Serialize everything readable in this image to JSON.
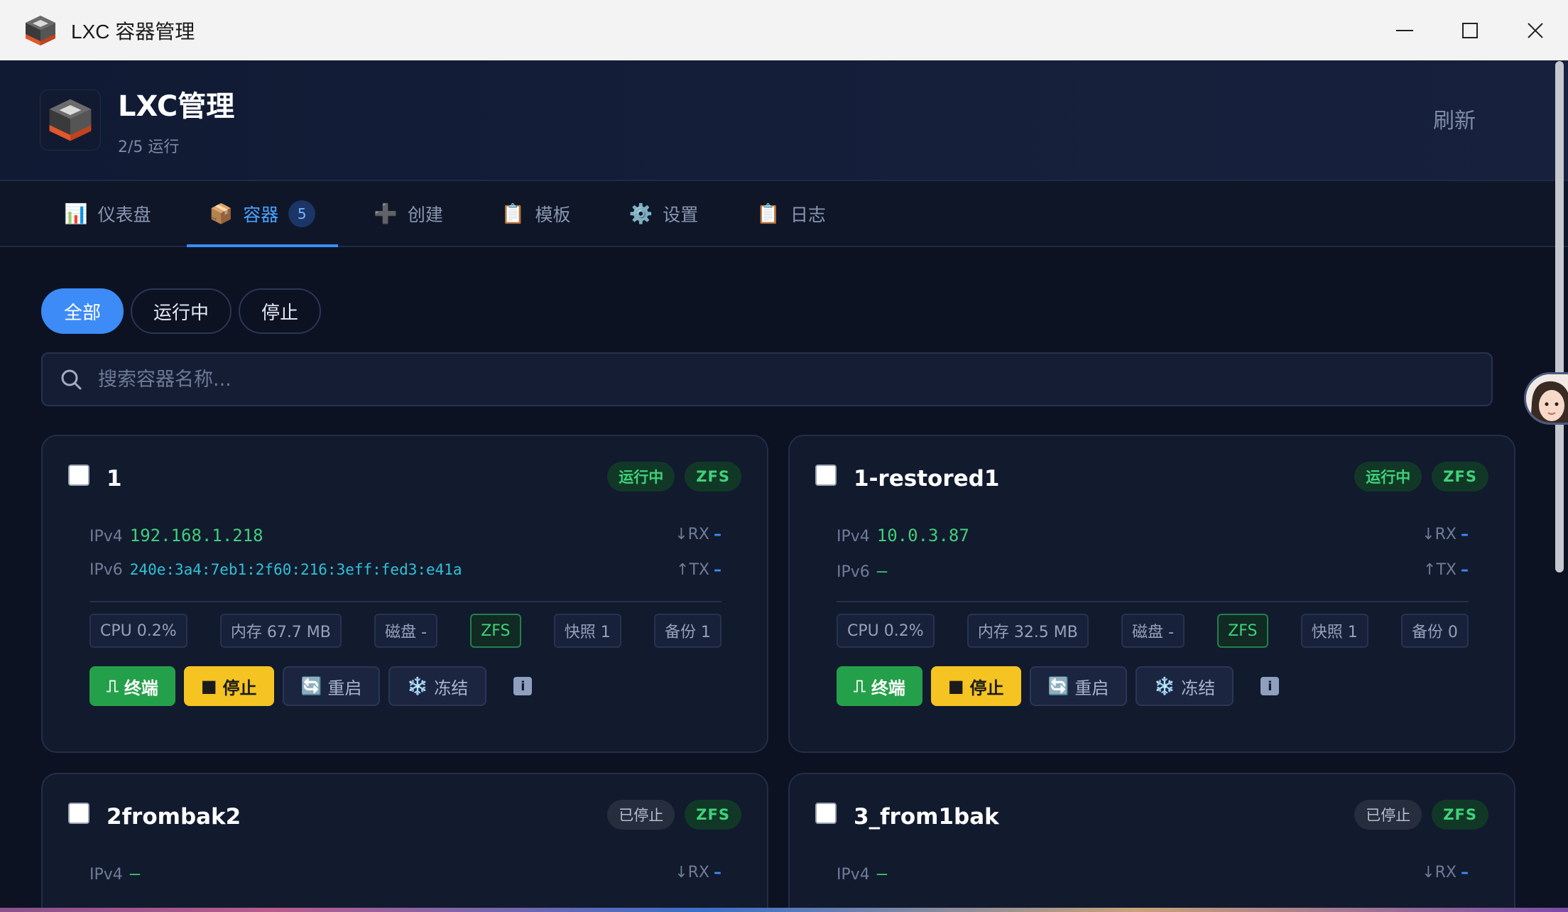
{
  "window": {
    "title": "LXC 容器管理"
  },
  "header": {
    "title": "LXC管理",
    "subtitle": "2/5 运行",
    "refresh_label": "刷新"
  },
  "tabs": [
    {
      "label": "仪表盘",
      "icon": "📊"
    },
    {
      "label": "容器",
      "icon": "📦",
      "badge": "5"
    },
    {
      "label": "创建",
      "icon": "➕"
    },
    {
      "label": "模板",
      "icon": "📋"
    },
    {
      "label": "设置",
      "icon": "⚙️"
    },
    {
      "label": "日志",
      "icon": "📋"
    }
  ],
  "filters": [
    "全部",
    "运行中",
    "停止"
  ],
  "search": {
    "placeholder": "搜索容器名称..."
  },
  "labels": {
    "ipv4": "IPv4",
    "ipv6": "IPv6",
    "rx": "↓RX",
    "tx": "↑TX",
    "dash": "–",
    "terminal": "终端",
    "stop": "停止",
    "restart": "重启",
    "freeze": "冻结",
    "info": "i"
  },
  "containers": [
    {
      "name": "1",
      "status": "运行中",
      "storage": "ZFS",
      "ipv4": "192.168.1.218",
      "ipv6": "240e:3a4:7eb1:2f60:216:3eff:fed3:e41a",
      "cpu": "CPU 0.2%",
      "mem": "内存 67.7 MB",
      "disk": "磁盘 -",
      "fs": "ZFS",
      "snap": "快照 1",
      "backup": "备份 1"
    },
    {
      "name": "1-restored1",
      "status": "运行中",
      "storage": "ZFS",
      "ipv4": "10.0.3.87",
      "ipv6": "–",
      "cpu": "CPU 0.2%",
      "mem": "内存 32.5 MB",
      "disk": "磁盘 -",
      "fs": "ZFS",
      "snap": "快照 1",
      "backup": "备份 0"
    },
    {
      "name": "2frombak2",
      "status": "已停止",
      "storage": "ZFS",
      "ipv4": "–"
    },
    {
      "name": "3_from1bak",
      "status": "已停止",
      "storage": "ZFS",
      "ipv4": "–"
    }
  ],
  "colors": {
    "accent": "#3d8bf7",
    "running": "#3fd27a",
    "terminal": "#25a04a",
    "stop": "#f5c422",
    "bg": "#0c1222"
  }
}
